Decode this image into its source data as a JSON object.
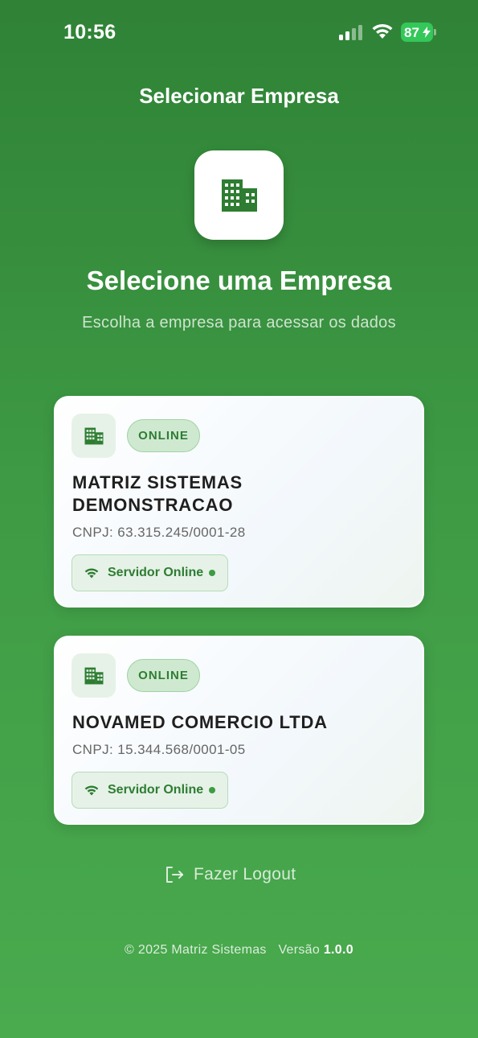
{
  "status_bar": {
    "time": "10:56",
    "battery": "87",
    "icons": [
      "signal-icon",
      "wifi-icon",
      "battery-charging-icon"
    ],
    "battery_color": "#34c759"
  },
  "header": {
    "screen_title": "Selecionar Empresa",
    "logo_icon": "building-icon",
    "headline": "Selecione uma Empresa",
    "subtitle": "Escolha a empresa para acessar os dados"
  },
  "companies": [
    {
      "name": "MATRIZ SISTEMAS DEMONSTRACAO",
      "badge": "ONLINE",
      "cnpj": "CNPJ: 63.315.245/0001-28",
      "server_status": "Servidor Online",
      "icon": "building-icon"
    },
    {
      "name": "NOVAMED COMERCIO LTDA",
      "badge": "ONLINE",
      "cnpj": "CNPJ: 15.344.568/0001-05",
      "server_status": "Servidor Online",
      "icon": "building-icon"
    }
  ],
  "logout": {
    "label": "Fazer Logout",
    "icon": "logout-icon"
  },
  "footer": {
    "copyright": "© 2025 Matriz Sistemas",
    "version_label": "Versão",
    "version_number": "1.0.0"
  },
  "colors": {
    "primary_green": "#2e7d32",
    "background_top": "#2f8236",
    "background_bottom": "#4aaa4e",
    "badge_bg": "#cfe9d1"
  }
}
